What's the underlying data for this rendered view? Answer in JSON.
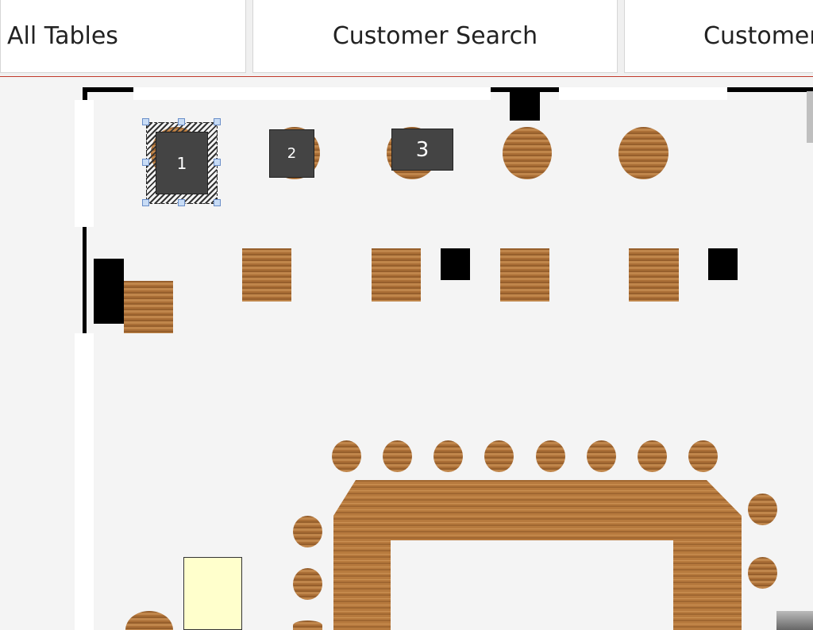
{
  "tabs": [
    {
      "label": "All Tables"
    },
    {
      "label": "Customer Search"
    },
    {
      "label": "Customer"
    }
  ],
  "tables": [
    {
      "number": "1",
      "selected": true
    },
    {
      "number": "2",
      "selected": false
    },
    {
      "number": "3",
      "selected": false
    }
  ],
  "colors": {
    "tab_rule": "#c0392b",
    "label_box": "#444444",
    "wood": "#b77a3e",
    "selection_handle": "#c8dcf5",
    "note": "#ffffcc"
  }
}
